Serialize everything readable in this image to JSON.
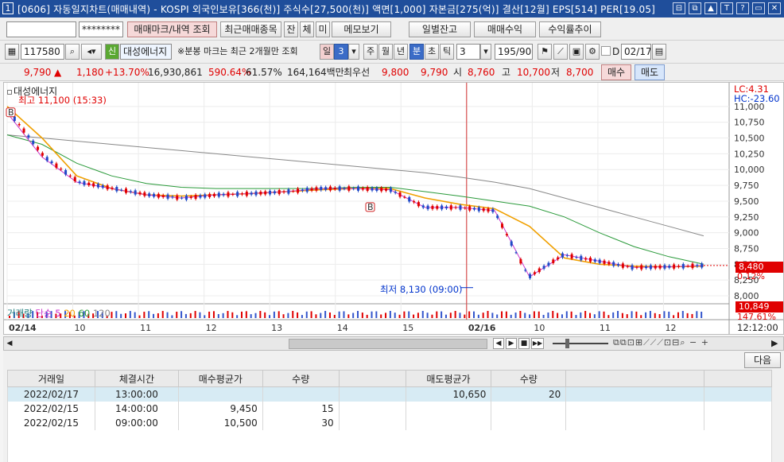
{
  "window": {
    "number": "1",
    "title": "[0606] 자동일지차트(매매내역) - KOSPI 외국인보유[366(천)] 주식수[27,500(천)] 액면[1,000] 자본금[275(억)] 결산[12월] EPS[514] PER[19.05]",
    "buttons": [
      "⊟",
      "⧉",
      "▲",
      "T",
      "?",
      "▭",
      "✕"
    ]
  },
  "toolbar1": {
    "account": "",
    "password": "********",
    "trade_mark_button": "매매마크/내역 조회",
    "recent_trades_button": "최근매매종목",
    "jan_button": "잔",
    "che_button": "체",
    "mi_button": "미",
    "memo_button": "메모보기",
    "daily_balance_button": "일별잔고",
    "trade_profit_button": "매매수익",
    "profit_trend_button": "수익률추이"
  },
  "toolbar2": {
    "code": "117580",
    "new_badge": "신",
    "stock_name": "대성에너지",
    "notice": "※분봉 마크는 최근 2개월만 조회",
    "period_day": "일",
    "period_value": "3",
    "period_week": "주",
    "period_month": "월",
    "period_year": "년",
    "period_min": "분",
    "period_sec": "초",
    "period_tick": "틱",
    "interval": "3",
    "count": "195/900",
    "checkbox_label": "D",
    "date": "02/17"
  },
  "price_row": {
    "price": "9,790",
    "arrow": "▲",
    "change": "1,180",
    "change_pct": "+13.70%",
    "volume": "16,930,861",
    "volume_ratio": "590.64%",
    "turnover_pct": "61.57%",
    "amount": "164,164백만",
    "best_label": "최우선",
    "ask": "9,800",
    "bid": "9,790",
    "open_label": "시",
    "open": "8,760",
    "high_label": "고",
    "high": "10,700",
    "low_label": "저",
    "low": "8,700",
    "buy_button": "매수",
    "sell_button": "매도"
  },
  "chart": {
    "legend_name": "대성에너지",
    "high_annot": "최고 11,100 (15:33)",
    "low_annot": "최저 8,130 (09:00)",
    "lc_label": "LC:4.31",
    "hc_label": "HC:-23.60",
    "cur_price_label": "8,480",
    "cur_pct_label": "0.12%",
    "vol_label": "10,849",
    "vol_pct_label": "147.61%",
    "volume_legend": [
      "거래량",
      "단순",
      "5",
      "20",
      "60",
      "120"
    ],
    "time_label": "12:12:00",
    "buy_marker": "B",
    "colors": {
      "ma5": "#cc33cc",
      "ma20": "#f0a000",
      "ma60": "#2a9a3a",
      "ma120": "#888888",
      "up": "#e00000",
      "down": "#1f49c7"
    }
  },
  "chart_data": {
    "type": "candlestick",
    "x_labels": [
      "02/14",
      "10",
      "11",
      "12",
      "13",
      "14",
      "15",
      "02/16",
      "10",
      "11",
      "12"
    ],
    "y_ticks": [
      11000,
      10750,
      10500,
      10250,
      10000,
      9750,
      9500,
      9250,
      9000,
      8750,
      8500,
      8250,
      8000
    ],
    "ylim": [
      7950,
      11250
    ],
    "series": [
      {
        "name": "5",
        "values": [
          10900,
          10200,
          9800,
          9700,
          9600,
          9550,
          9600,
          9620,
          9650,
          9700,
          9700,
          9680,
          9400,
          9400,
          9350,
          8300,
          8650,
          8550,
          8450,
          8460,
          8480
        ]
      },
      {
        "name": "20",
        "values": [
          11000,
          10500,
          9900,
          9700,
          9600,
          9580,
          9600,
          9620,
          9650,
          9680,
          9700,
          9700,
          9550,
          9450,
          9380,
          9100,
          8600,
          8500,
          8470,
          8460,
          8470
        ]
      },
      {
        "name": "60",
        "values": [
          10550,
          10400,
          10100,
          9900,
          9780,
          9720,
          9700,
          9700,
          9700,
          9700,
          9720,
          9720,
          9650,
          9580,
          9500,
          9420,
          9250,
          9000,
          8780,
          8620,
          8500
        ]
      },
      {
        "name": "120",
        "values": [
          10550,
          10500,
          10450,
          10400,
          10350,
          10300,
          10250,
          10200,
          10150,
          10100,
          10050,
          10000,
          9950,
          9880,
          9800,
          9700,
          9550,
          9400,
          9250,
          9100,
          8950
        ]
      }
    ]
  },
  "scroll": {
    "btns": [
      "◀",
      "▶",
      "■",
      "▶▶"
    ]
  },
  "grid": {
    "next_button": "다음",
    "headers": [
      "거래일",
      "체결시간",
      "매수평균가",
      "수량",
      "",
      "매도평균가",
      "수량",
      "",
      ""
    ],
    "rows": [
      [
        "2022/02/17",
        "13:00:00",
        "",
        "",
        "",
        "10,650",
        "20",
        "",
        ""
      ],
      [
        "2022/02/15",
        "14:00:00",
        "9,450",
        "15",
        "",
        "",
        "",
        "",
        ""
      ],
      [
        "2022/02/15",
        "09:00:00",
        "10,500",
        "30",
        "",
        "",
        "",
        "",
        ""
      ]
    ]
  }
}
